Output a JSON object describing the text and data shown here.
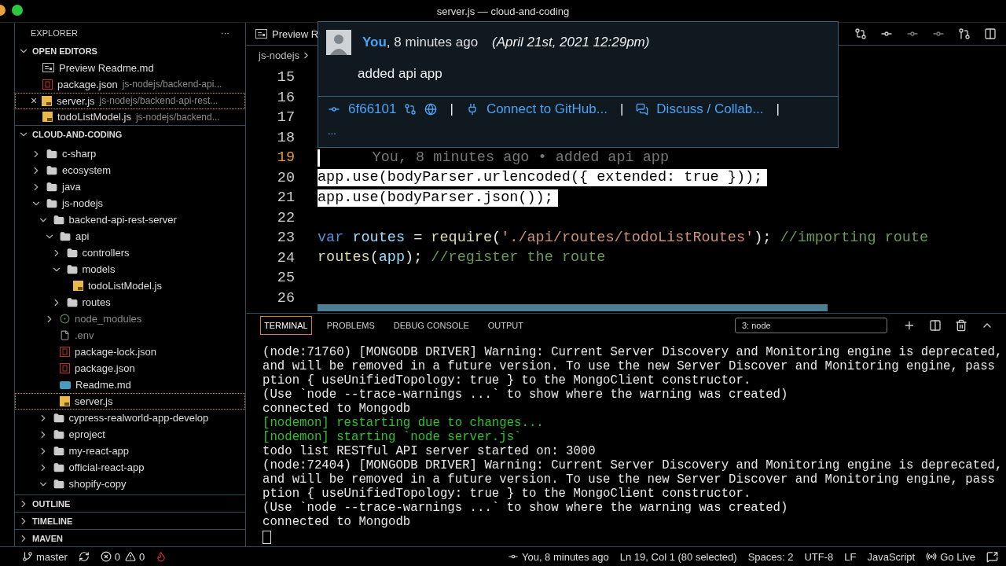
{
  "window": {
    "title": "server.js — cloud-and-coding"
  },
  "sidebar": {
    "title": "EXPLORER",
    "more": "···",
    "open_editors": {
      "title": "OPEN EDITORS",
      "expanded": true,
      "items": [
        {
          "name": "Preview Readme.md",
          "kind": "preview",
          "selected": false
        },
        {
          "name": "package.json",
          "path": "js-nodejs/backend-api...",
          "kind": "json",
          "selected": false
        },
        {
          "name": "server.js",
          "path": "js-nodejs/backend-api-rest...",
          "kind": "js",
          "selected": true,
          "close": "×"
        },
        {
          "name": "todoListModel.js",
          "path": "js-nodejs/backend...",
          "kind": "js",
          "selected": false
        }
      ]
    },
    "folder": {
      "title": "CLOUD-AND-CODING",
      "expanded": true,
      "tree": [
        {
          "name": "c-sharp",
          "kind": "folder",
          "expanded": false,
          "selected": false
        },
        {
          "name": "ecosystem",
          "kind": "folder",
          "expanded": false,
          "selected": false
        },
        {
          "name": "java",
          "kind": "folder",
          "expanded": false,
          "selected": false
        },
        {
          "name": "js-nodejs",
          "kind": "folder",
          "expanded": true,
          "selected": false,
          "children": [
            {
              "name": "backend-api-rest-server",
              "kind": "folder",
              "expanded": true,
              "selected": false,
              "children": [
                {
                  "name": "api",
                  "kind": "folder",
                  "expanded": true,
                  "selected": false,
                  "children": [
                    {
                      "name": "controllers",
                      "kind": "folder",
                      "expanded": false,
                      "selected": false
                    },
                    {
                      "name": "models",
                      "kind": "folder",
                      "expanded": true,
                      "selected": false,
                      "children": [
                        {
                          "name": "todoListModel.js",
                          "kind": "js",
                          "selected": false
                        }
                      ]
                    },
                    {
                      "name": "routes",
                      "kind": "folder",
                      "expanded": false,
                      "selected": false
                    }
                  ]
                },
                {
                  "name": "node_modules",
                  "kind": "modules",
                  "expanded": false,
                  "selected": false
                },
                {
                  "name": ".env",
                  "kind": "env",
                  "selected": false
                },
                {
                  "name": "package-lock.json",
                  "kind": "json",
                  "selected": false
                },
                {
                  "name": "package.json",
                  "kind": "json",
                  "selected": false
                },
                {
                  "name": "Readme.md",
                  "kind": "md",
                  "selected": false
                },
                {
                  "name": "server.js",
                  "kind": "js",
                  "selected": true
                }
              ]
            },
            {
              "name": "cypress-realworld-app-develop",
              "kind": "folder",
              "expanded": false,
              "selected": false
            },
            {
              "name": "eproject",
              "kind": "folder",
              "expanded": false,
              "selected": false
            },
            {
              "name": "my-react-app",
              "kind": "folder",
              "expanded": false,
              "selected": false
            },
            {
              "name": "official-react-app",
              "kind": "folder",
              "expanded": false,
              "selected": false
            },
            {
              "name": "shopify-copy",
              "kind": "folder",
              "expanded": true,
              "selected": false
            }
          ]
        }
      ]
    },
    "sections": [
      {
        "title": "OUTLINE",
        "expanded": false
      },
      {
        "title": "TIMELINE",
        "expanded": false
      },
      {
        "title": "MAVEN",
        "expanded": false
      }
    ]
  },
  "editor": {
    "tab": "Preview R",
    "breadcrumb": "js-nodejs",
    "lines": [
      {
        "number": "15",
        "current": false
      },
      {
        "number": "16",
        "current": false
      },
      {
        "number": "17",
        "current": false
      },
      {
        "number": "18",
        "current": false
      },
      {
        "number": "19",
        "current": true,
        "selected": false,
        "tokens": [
          {
            "text": "      You, 8 minutes ago • added api app",
            "kind": "blame"
          }
        ]
      },
      {
        "number": "20",
        "current": false,
        "selected": true,
        "tokens": [
          {
            "text": "app.use(bodyParser.urlencoded({ extended: true }));",
            "kind": "plain"
          }
        ]
      },
      {
        "number": "21",
        "current": false,
        "selected": true,
        "tokens": [
          {
            "text": "app.use(bodyParser.json());",
            "kind": "plain"
          }
        ]
      },
      {
        "number": "22",
        "current": false,
        "selected": false
      },
      {
        "number": "23",
        "current": false,
        "selected": false,
        "tokens": [
          {
            "text": "var",
            "kind": "keyword"
          },
          {
            "text": " routes",
            "kind": "variable"
          },
          {
            "text": " = ",
            "kind": "plain"
          },
          {
            "text": "require",
            "kind": "function"
          },
          {
            "text": "(",
            "kind": "plain"
          },
          {
            "text": "'./api/routes/todoListRoutes'",
            "kind": "string"
          },
          {
            "text": "); ",
            "kind": "plain"
          },
          {
            "text": "//importing route",
            "kind": "comment"
          }
        ]
      },
      {
        "number": "24",
        "current": false,
        "selected": false,
        "tokens": [
          {
            "text": "routes",
            "kind": "function"
          },
          {
            "text": "(",
            "kind": "plain"
          },
          {
            "text": "app",
            "kind": "variable"
          },
          {
            "text": "); ",
            "kind": "plain"
          },
          {
            "text": "//register the route",
            "kind": "comment"
          }
        ]
      },
      {
        "number": "25",
        "current": false,
        "selected": false
      },
      {
        "number": "26",
        "current": false,
        "selected": false
      }
    ]
  },
  "hover": {
    "author": "You",
    "time": ", 8 minutes ago",
    "date": "(April 21st, 2021 12:29pm)",
    "message": "added api app",
    "sha": "6f66101",
    "links": [
      "Connect to GitHub...",
      "Discuss / Collab..."
    ],
    "separator": "|",
    "more": "..."
  },
  "panel": {
    "tabs": [
      {
        "label": "TERMINAL",
        "selected": true
      },
      {
        "label": "PROBLEMS",
        "selected": false
      },
      {
        "label": "DEBUG CONSOLE",
        "selected": false
      },
      {
        "label": "OUTPUT",
        "selected": false
      }
    ],
    "terminal_select": "3: node",
    "lines": [
      {
        "text": "(node:71760) [MONGODB DRIVER] Warning: Current Server Discovery and Monitoring engine is deprecated,",
        "kind": "plain"
      },
      {
        "text": "and will be removed in a future version. To use the new Server Discover and Monitoring engine, pass",
        "kind": "plain"
      },
      {
        "text": "ption { useUnifiedTopology: true } to the MongoClient constructor.",
        "kind": "plain"
      },
      {
        "text": "(Use `node --trace-warnings ...` to show where the warning was created)",
        "kind": "plain"
      },
      {
        "text": "connected to Mongodb",
        "kind": "plain"
      },
      {
        "text": "[nodemon] restarting due to changes...",
        "kind": "nodemon"
      },
      {
        "text": "[nodemon] starting `node server.js`",
        "kind": "nodemon"
      },
      {
        "text": "todo list RESTful API server started on: 3000",
        "kind": "plain"
      },
      {
        "text": "(node:72404) [MONGODB DRIVER] Warning: Current Server Discovery and Monitoring engine is deprecated,",
        "kind": "plain"
      },
      {
        "text": "and will be removed in a future version. To use the new Server Discover and Monitoring engine, pass",
        "kind": "plain"
      },
      {
        "text": "ption { useUnifiedTopology: true } to the MongoClient constructor.",
        "kind": "plain"
      },
      {
        "text": "(Use `node --trace-warnings ...` to show where the warning was created)",
        "kind": "plain"
      },
      {
        "text": "connected to Mongodb",
        "kind": "plain"
      }
    ]
  },
  "status_bar": {
    "branch": "master",
    "errors": "0",
    "warnings": "0",
    "blame": "You, 8 minutes ago",
    "position": "Ln 19, Col 1 (80 selected)",
    "spaces": "Spaces: 2",
    "encoding": "UTF-8",
    "eol": "LF",
    "language": "JavaScript",
    "go_live": "Go Live"
  }
}
